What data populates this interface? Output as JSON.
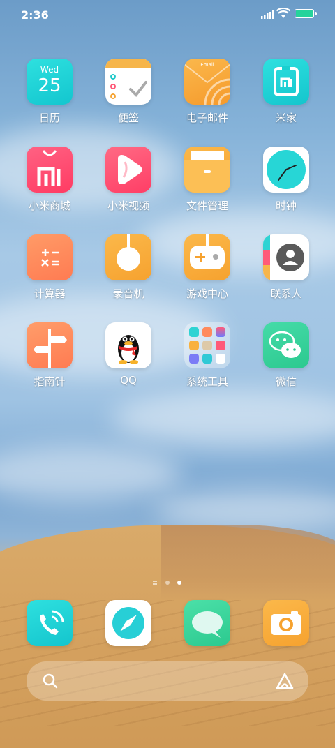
{
  "status_bar": {
    "time": "2:36",
    "battery_level": 1.0
  },
  "apps": [
    {
      "id": "calendar",
      "label": "日历",
      "day": "Wed",
      "date": "25"
    },
    {
      "id": "notes",
      "label": "便签"
    },
    {
      "id": "email",
      "label": "电子邮件",
      "icon_text": "Email"
    },
    {
      "id": "mijia",
      "label": "米家"
    },
    {
      "id": "mall",
      "label": "小米商城"
    },
    {
      "id": "video",
      "label": "小米视频"
    },
    {
      "id": "files",
      "label": "文件管理"
    },
    {
      "id": "clock",
      "label": "时钟"
    },
    {
      "id": "calculator",
      "label": "计算器",
      "icon_text": "+ −\n× ="
    },
    {
      "id": "recorder",
      "label": "录音机"
    },
    {
      "id": "gamecenter",
      "label": "游戏中心"
    },
    {
      "id": "contacts",
      "label": "联系人"
    },
    {
      "id": "compass",
      "label": "指南针"
    },
    {
      "id": "qq",
      "label": "QQ"
    },
    {
      "id": "systemtools",
      "label": "系统工具"
    },
    {
      "id": "wechat",
      "label": "微信"
    }
  ],
  "page_indicator": {
    "pages": 3,
    "current": 3
  },
  "dock": [
    {
      "id": "phone",
      "icon": "phone-icon"
    },
    {
      "id": "browser",
      "icon": "compass-browser-icon"
    },
    {
      "id": "messages",
      "icon": "message-bubble-icon"
    },
    {
      "id": "camera",
      "icon": "camera-icon"
    }
  ],
  "search_bar": {
    "left_icon": "search-icon",
    "right_icon": "assistant-icon"
  },
  "colors": {
    "calendar": "#1fd3d3",
    "notes": "#f6b54a",
    "email": "#f7a83b",
    "mijia": "#1fd0d0",
    "mall": "#ff4d71",
    "video": "#ff4f71",
    "files": "#f8ad3b",
    "clock": "#ffffff",
    "calculator": "#ff8a5c",
    "recorder": "#f9b13f",
    "gamecenter": "#f8ae3c",
    "contacts": "#ffffff",
    "compass": "#ff8c5e",
    "qq": "#ffffff",
    "wechat": "#36d49b",
    "phone": "#21d6cf",
    "messages": "#36d48d",
    "camera": "#f9ad3b"
  }
}
